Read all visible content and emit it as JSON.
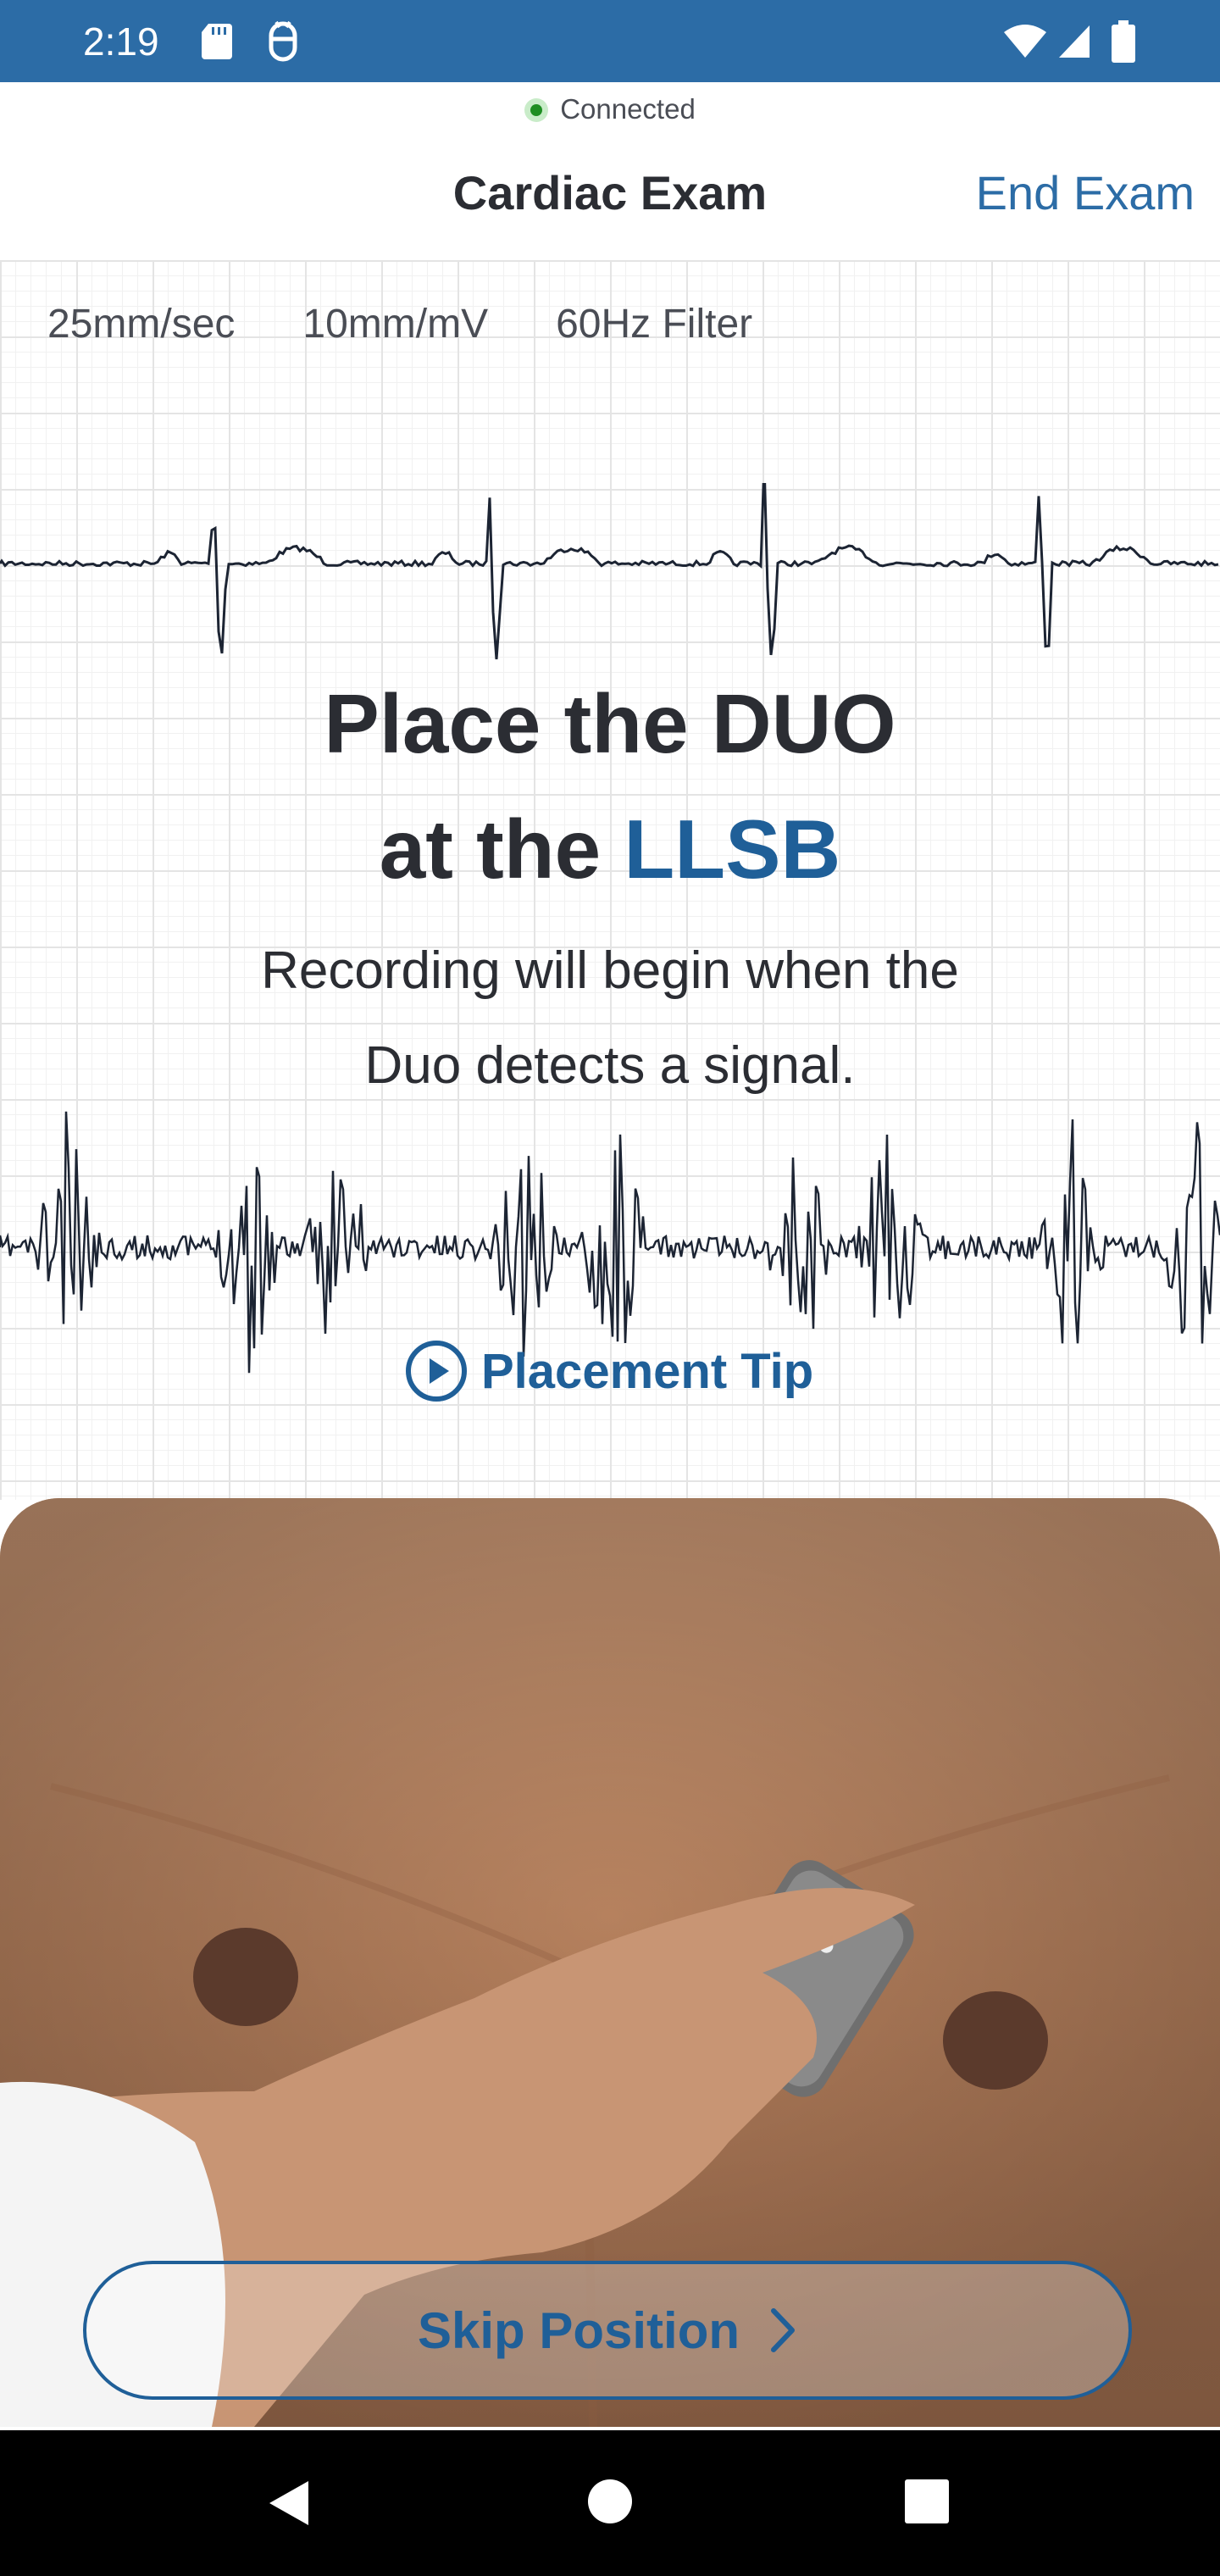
{
  "status_bar": {
    "time": "2:19",
    "background": "#2c6ca6",
    "icons": [
      "sd-card-icon",
      "android-debug-icon",
      "wifi-icon",
      "signal-icon",
      "battery-icon"
    ]
  },
  "connection": {
    "status": "Connected",
    "color": "#1e8e22"
  },
  "header": {
    "title": "Cardiac Exam",
    "end_button": "End Exam"
  },
  "ecg_settings": [
    "25mm/sec",
    "10mm/mV",
    "60Hz Filter"
  ],
  "instruction": {
    "line1": "Place the DUO",
    "line2_prefix": "at the ",
    "position": "LLSB",
    "subtitle_line1": "Recording will begin when the",
    "subtitle_line2": "Duo detects a signal."
  },
  "placement_tip": {
    "label": "Placement Tip",
    "icon": "play-circle-icon"
  },
  "skip_button": {
    "label": "Skip Position",
    "icon": "chevron-right-icon"
  },
  "colors": {
    "accent": "#2c6ca6",
    "accent_dark": "#1f5f98",
    "text": "#2b2d33"
  },
  "nav_bar": {
    "icons": [
      "back-icon",
      "home-icon",
      "recents-icon"
    ]
  }
}
